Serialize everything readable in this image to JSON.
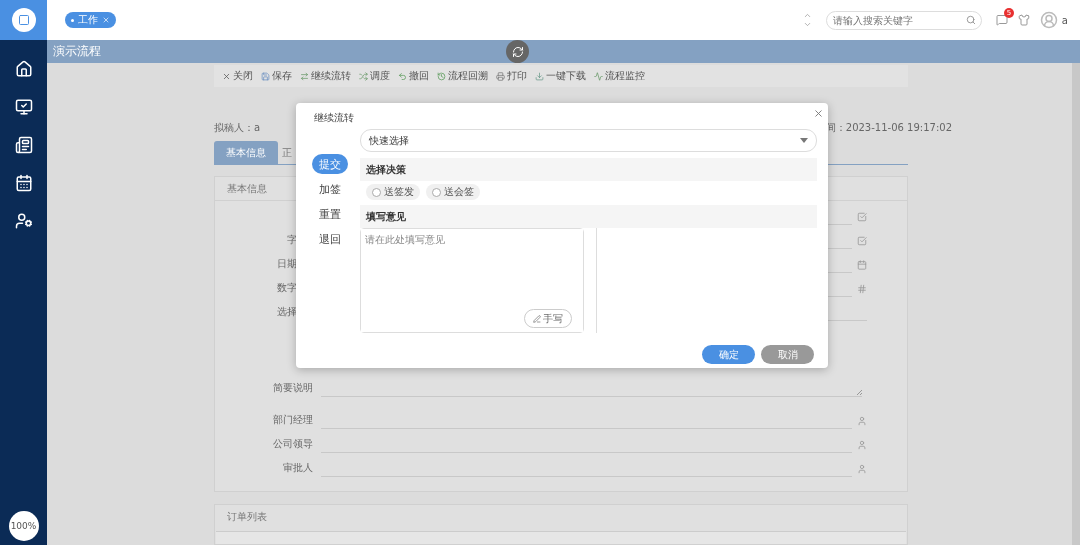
{
  "top_bar": {
    "tags": [
      {
        "label": "工作"
      }
    ],
    "search": {
      "placeholder": "请输入搜索关键字"
    },
    "notification_count": "5",
    "user": "a"
  },
  "sidebar": {
    "zoom": "100%"
  },
  "page_title": "演示流程",
  "toolbar": [
    "关闭",
    "保存",
    "继续流转",
    "调度",
    "撤回",
    "流程回溯",
    "打印",
    "一键下载",
    "流程监控"
  ],
  "document": {
    "drafter": "拟稿人：a",
    "time": "间：2023-11-06 19:17:02",
    "tabs": [
      {
        "label": "基本信息",
        "selected": true
      },
      {
        "label": "正",
        "selected": false
      }
    ],
    "section_title": "基本信息",
    "fields_top": [
      {
        "kind": "check"
      },
      {
        "label": "字",
        "kind": "check"
      },
      {
        "label": "日期",
        "kind": "date"
      },
      {
        "label": "数字",
        "kind": "number"
      },
      {
        "label": "选择",
        "kind": "line"
      }
    ],
    "fields_bottom": [
      {
        "label": "简要说明",
        "kind": "textarea"
      },
      {
        "label": "部门经理",
        "kind": "person"
      },
      {
        "label": "公司领导",
        "kind": "person"
      },
      {
        "label": "审批人",
        "kind": "person"
      }
    ],
    "order_section": "订单列表"
  },
  "dialog": {
    "title": "继续流转",
    "quick_select": {
      "value": "快速选择"
    },
    "actions": [
      {
        "label": "提交",
        "selected": true
      },
      {
        "label": "加签",
        "selected": false
      },
      {
        "label": "重置",
        "selected": false
      },
      {
        "label": "退回",
        "selected": false
      }
    ],
    "decision_title": "选择决策",
    "options": [
      {
        "label": "送签发",
        "checked": false
      },
      {
        "label": "送会签",
        "checked": false
      }
    ],
    "opinion_title": "填写意见",
    "opinion": {
      "placeholder": "请在此处填写意见"
    },
    "handwrite": "手写",
    "buttons": [
      {
        "label": "确定",
        "kind": "primary"
      },
      {
        "label": "取消",
        "kind": "secondary"
      }
    ]
  }
}
